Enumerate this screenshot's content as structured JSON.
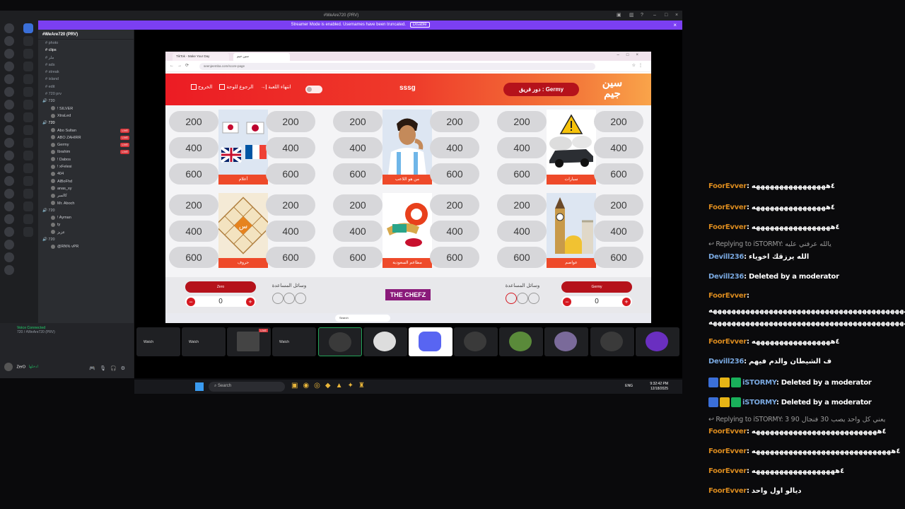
{
  "discord": {
    "window_title": "#WeAre720 (PRV)",
    "streamer_notice": "Streamer Mode is enabled. Usernames have been truncated.",
    "disable_label": "Disable",
    "server_name": "#WeAre720 (PRV)",
    "channels": [
      "photo",
      "clips",
      "ملر",
      "ads",
      "streak",
      "island",
      "edit",
      "720 prv"
    ],
    "categories": [
      "720",
      "720",
      "720"
    ],
    "voice_users_a": [
      "! SILVER",
      "XtraLed"
    ],
    "voice_users_b": [
      "Abo Sultan",
      "ABO ZAHIRR",
      "Germy",
      "Ibrahim",
      "! Dabos",
      "! xFelesi",
      "404",
      "AlBoFhd",
      "anas_xy",
      "كالسر",
      "Mr. Aboch"
    ],
    "voice_users_c": [
      "! Ayman",
      "ty",
      "عزيز"
    ],
    "voice_users_d": [
      "@RN% vPR"
    ],
    "live_label": "LIVE",
    "voice_connected": "Voice Connected",
    "voice_sub": "720 / #WeAre720 (PRV)",
    "user_name": "ZerO",
    "user_status": "ادخلها"
  },
  "browser": {
    "tab1": "TikTok - Make Your Day",
    "tab2": "سين جيم",
    "url": "seenjeemba.com/score-page"
  },
  "game": {
    "exit_label": "الخروج",
    "back_label": "الرجوع للوحة",
    "end_label": "انتهاء اللعبة",
    "code": "sssg",
    "turn_label": "دور فريق : Germy",
    "logo": "سين جيم",
    "categories": [
      {
        "name": "أعلام",
        "values": [
          200,
          400,
          600
        ]
      },
      {
        "name": "من هو اللاعب",
        "values": [
          200,
          400,
          600
        ]
      },
      {
        "name": "سيارات",
        "values": [
          200,
          400,
          600
        ]
      },
      {
        "name": "حروف",
        "values": [
          200,
          400,
          600
        ]
      },
      {
        "name": "مطاعم السعودية",
        "values": [
          200,
          400,
          600
        ]
      },
      {
        "name": "عواصم",
        "values": [
          200,
          400,
          600
        ]
      }
    ],
    "team_left": {
      "name": "Zero",
      "score": "0"
    },
    "team_right": {
      "name": "Germy",
      "score": "0"
    },
    "helpers_label": "وسائل المساعدة",
    "sponsor": "THE CHEFZ",
    "search": "Search"
  },
  "tiles": [
    "Watch",
    "Watch",
    "Watch"
  ],
  "taskbar": {
    "search": "Search",
    "lang": "ENG",
    "time": "9:32:42 PM",
    "date": "12/18/2025"
  },
  "chat": [
    {
      "user": "FoorEvver",
      "text": ": ٤ههههههههههههههههه"
    },
    {
      "user": "FoorEvver",
      "text": ": ٤ههههههههههههههههه"
    },
    {
      "user": "FoorEvver",
      "text": ": ٤هههههههههههههههههه"
    },
    {
      "reply": "Replying to iSTORMY: يالله عرفني عليه"
    },
    {
      "user": "Devill236",
      "text": ": الله يرزقك اخوياء"
    },
    {
      "user": "Devill236",
      "text": ": Deleted by a moderator"
    },
    {
      "user": "FoorEvver",
      "text": ":"
    },
    {
      "text": "٤هههههههههههههههههههههههههههههههههههههههههههههههههه"
    },
    {
      "text": "٤هههههههههههههههههههههههههههههههههههههههههههه"
    },
    {
      "user": "FoorEvver",
      "text": ": ٤هههههههههههههههههه"
    },
    {
      "user": "Devill236",
      "text": ": ف الشيطان والدم فيهم"
    },
    {
      "user": "iSTORMY",
      "text": ": Deleted by a moderator"
    },
    {
      "user": "iSTORMY",
      "text": ": Deleted by a moderator"
    },
    {
      "reply": "Replying to iSTORMY: 3 يعني كل واحد يصب 30 فنجال 90"
    },
    {
      "user": "FoorEvver",
      "text": ": ٤هههههههههههههههههههههههههههه"
    },
    {
      "user": "FoorEvver",
      "text": ": ٤ههههههههههههههههههههههههههههههه"
    },
    {
      "user": "FoorEvver",
      "text": ": ٤ههههههههههههههههههه"
    },
    {
      "user": "FoorEvver",
      "text": ": ديالو اول واحد"
    }
  ]
}
